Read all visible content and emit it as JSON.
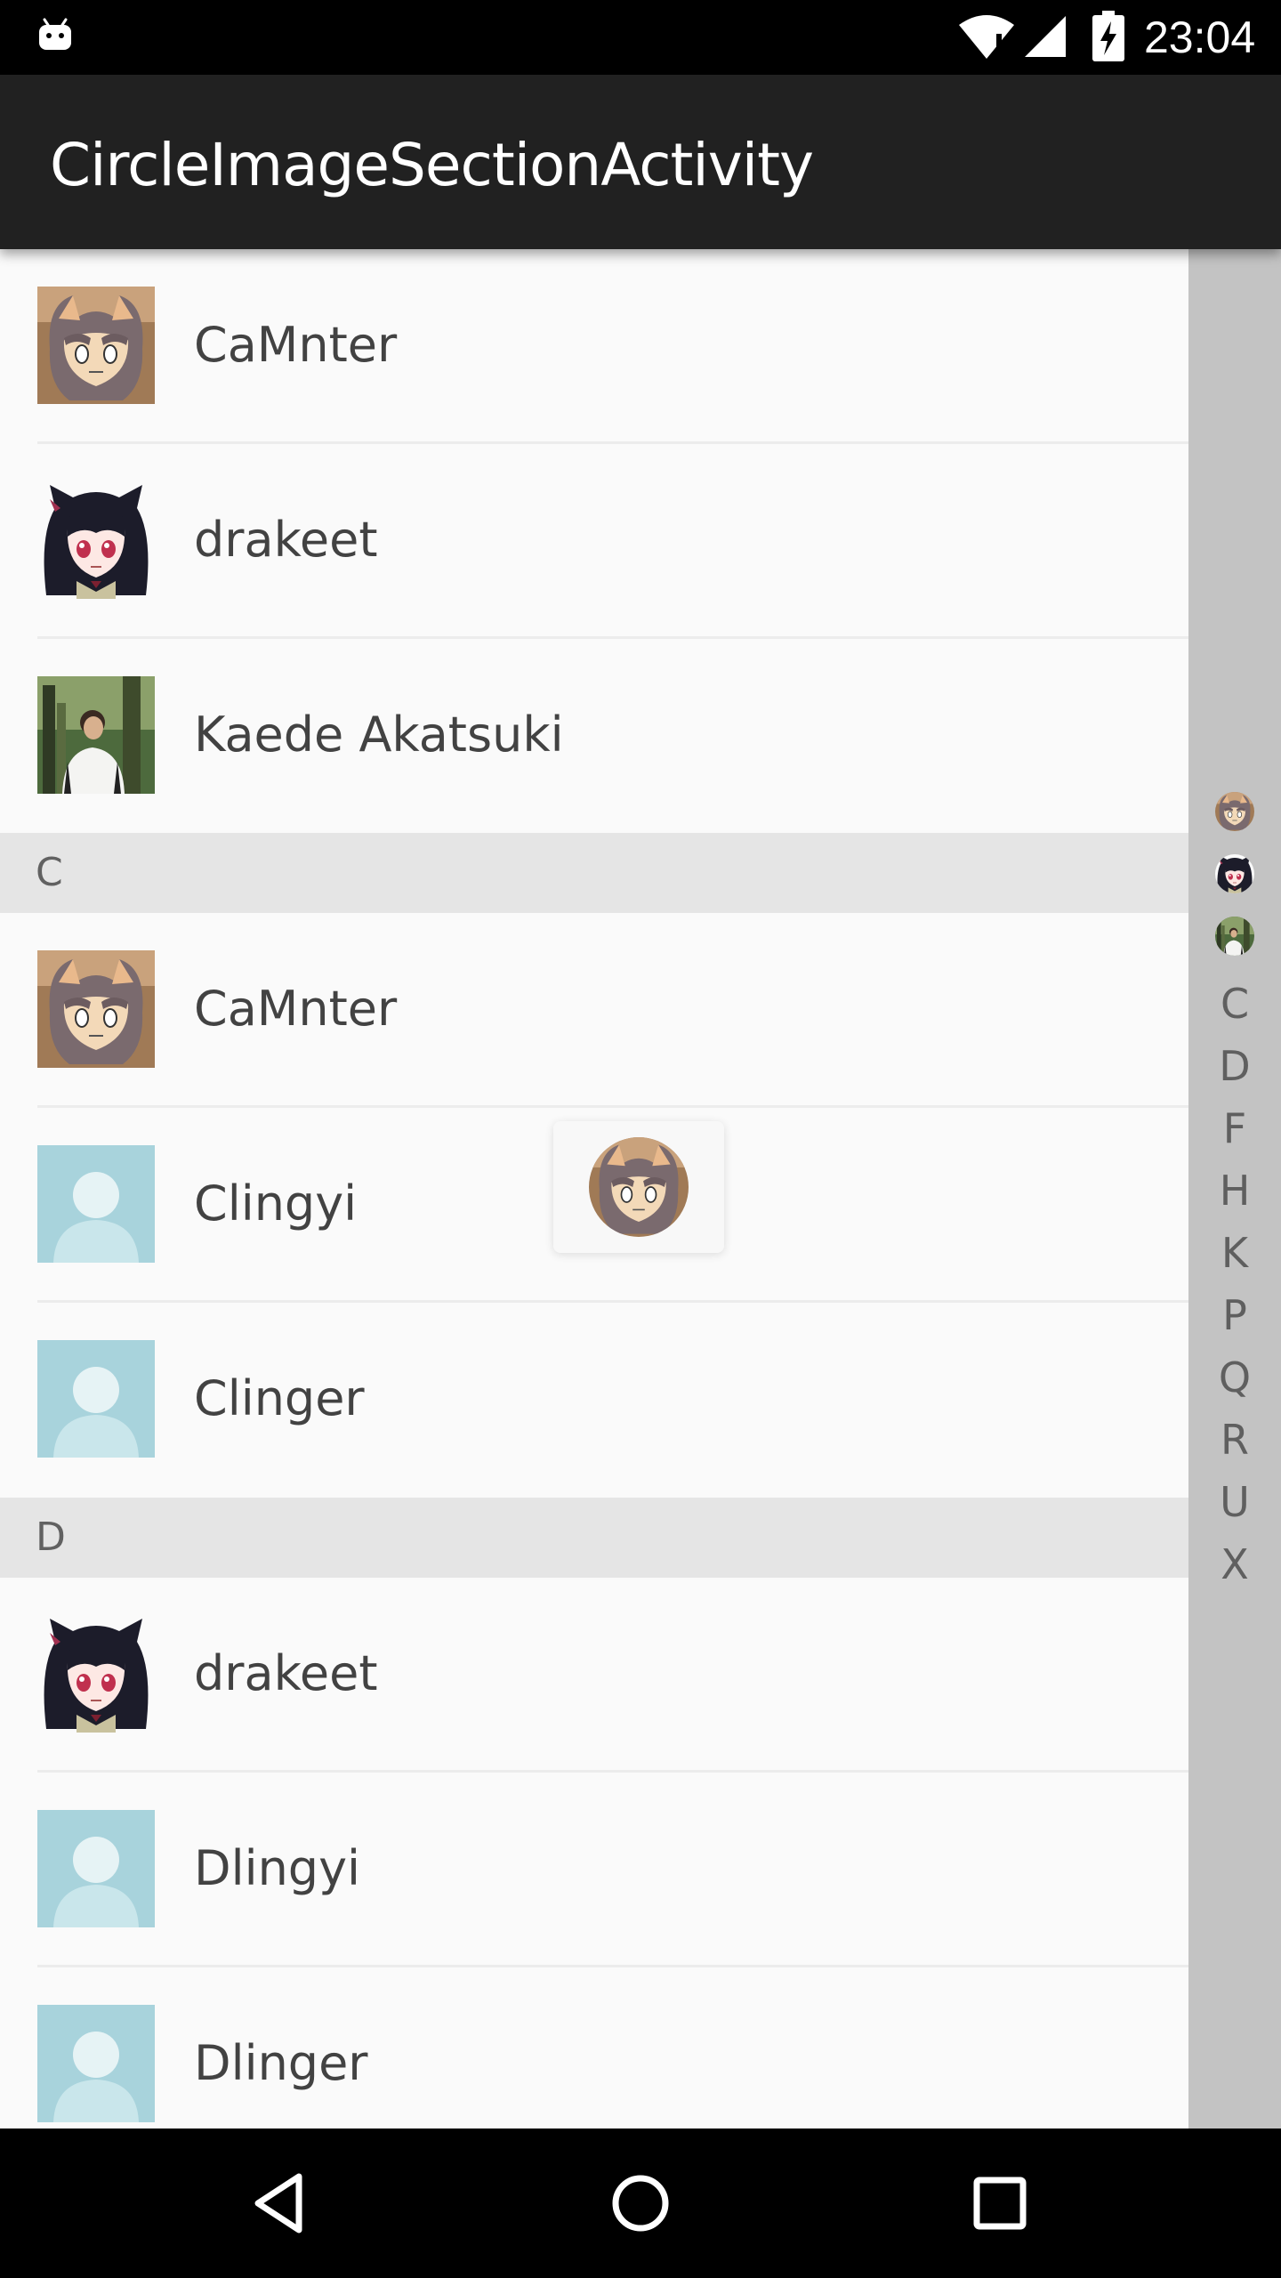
{
  "status_bar": {
    "time": "23:04",
    "icons": [
      "android-notification-icon",
      "wifi-icon",
      "signal-icon",
      "battery-charging-icon"
    ]
  },
  "toolbar": {
    "title": "CircleImageSectionActivity"
  },
  "list": {
    "rows": [
      {
        "name": "CaMnter",
        "avatar": "cat-girl-avatar"
      },
      {
        "name": "drakeet",
        "avatar": "black-hair-girl-avatar"
      },
      {
        "name": "Kaede Akatsuki",
        "avatar": "photo-person-avatar"
      }
    ],
    "sections": [
      {
        "letter": "C",
        "rows": [
          {
            "name": "CaMnter",
            "avatar": "cat-girl-avatar"
          },
          {
            "name": "Clingyi",
            "avatar": "default-person-avatar"
          },
          {
            "name": "Clinger",
            "avatar": "default-person-avatar"
          }
        ]
      },
      {
        "letter": "D",
        "rows": [
          {
            "name": "drakeet",
            "avatar": "black-hair-girl-avatar"
          },
          {
            "name": "Dlingyi",
            "avatar": "default-person-avatar"
          },
          {
            "name": "Dlinger",
            "avatar": "default-person-avatar"
          }
        ]
      }
    ]
  },
  "index_bar": {
    "image_items": [
      "cat-girl-avatar",
      "black-hair-girl-avatar",
      "photo-person-avatar"
    ],
    "letters": [
      "C",
      "D",
      "F",
      "H",
      "K",
      "P",
      "Q",
      "R",
      "U",
      "X"
    ]
  },
  "popup": {
    "avatar": "cat-girl-avatar"
  },
  "nav_bar": {
    "buttons": [
      "back",
      "home",
      "recents"
    ]
  },
  "colors": {
    "status_bar": "#000000",
    "toolbar": "#212121",
    "list_background": "#fafafa",
    "section_header": "#e5e5e5",
    "index_bar": "#c3c3c3",
    "default_avatar": "#a8d3dc"
  }
}
